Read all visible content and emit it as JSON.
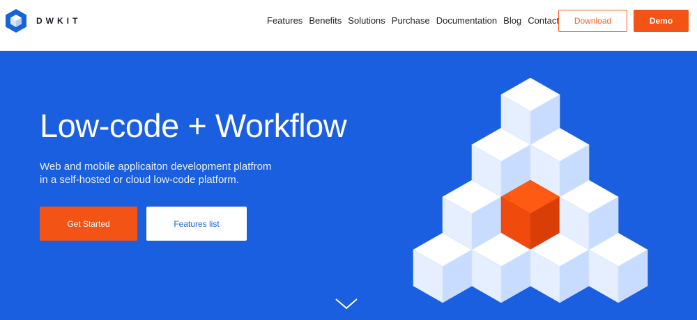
{
  "brand": {
    "name": "DWKIT",
    "logo_icon": "cube-hexagon-logo"
  },
  "nav": {
    "links": [
      "Features",
      "Benefits",
      "Solutions",
      "Purchase",
      "Documentation",
      "Blog",
      "Contacts"
    ],
    "download_label": "Download",
    "demo_label": "Demo"
  },
  "hero": {
    "title": "Low-code + Workflow",
    "subtitle_line1": "Web and mobile applicaiton development platfrom",
    "subtitle_line2": "in a self-hosted or cloud low-code platform.",
    "get_started_label": "Get Started",
    "features_list_label": "Features list",
    "scroll_icon": "chevron-down-icon"
  },
  "colors": {
    "accent": "#f35315",
    "hero_background": "#1a5fdf",
    "nav_background": "#ffffff"
  }
}
